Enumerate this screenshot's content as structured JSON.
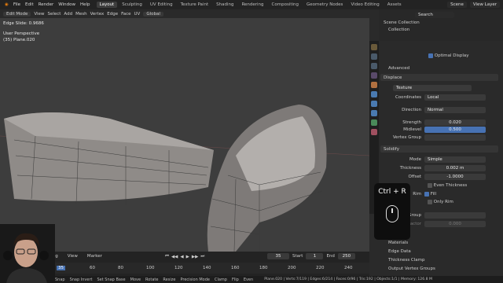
{
  "menu": [
    "File",
    "Edit",
    "Render",
    "Window",
    "Help"
  ],
  "workspaces": [
    "Layout",
    "Sculpting",
    "UV Editing",
    "Texture Paint",
    "Shading",
    "Rendering",
    "Compositing",
    "Geometry Nodes",
    "Video Editing",
    "Assets"
  ],
  "scene_label": "Scene",
  "view_layer_label": "View Layer",
  "header": {
    "mode": "Edit Mode",
    "items": [
      "View",
      "Select",
      "Add",
      "Mesh",
      "Vertex",
      "Edge",
      "Face",
      "UV"
    ],
    "transform": "Global"
  },
  "viewport": {
    "edge_slide": "Edge Slide: 0.9686",
    "perspective": "User Perspective",
    "object": "(35) Plane.020"
  },
  "outliner": {
    "search_placeholder": "Search",
    "scene_collection": "Scene Collection",
    "collection": "Collection"
  },
  "properties": {
    "optimal_display": "Optimal Display",
    "advanced": "Advanced",
    "displace": {
      "name": "Displace",
      "texture": "Texture",
      "coordinates_label": "Coordinates",
      "coordinates": "Local",
      "direction_label": "Direction",
      "direction": "Normal",
      "strength_label": "Strength",
      "strength": "0.020",
      "midlevel_label": "Midlevel",
      "midlevel": "0.500",
      "vertex_group_label": "Vertex Group"
    },
    "solidify": {
      "name": "Solidify",
      "mode_label": "Mode",
      "mode": "Simple",
      "thickness_label": "Thickness",
      "thickness": "0.002 m",
      "offset_label": "Offset",
      "offset": "-1.0000",
      "even_thickness": "Even Thickness",
      "rim_label": "Rim",
      "fill": "Fill",
      "only_rim": "Only Rim",
      "group_label": "x Group",
      "factor_label": "Factor",
      "factor": "0.000"
    },
    "panels": [
      "Materials",
      "Edge Data",
      "Thickness Clamp",
      "Output Vertex Groups"
    ]
  },
  "shortcut": {
    "keys": "Ctrl + R"
  },
  "timeline": {
    "playback": "ying",
    "view": "View",
    "marker": "Marker",
    "frame": "35",
    "start_label": "Start",
    "start": "1",
    "end_label": "End",
    "end": "250",
    "ticks": [
      "35",
      "60",
      "80",
      "100",
      "120",
      "140",
      "160",
      "180",
      "200",
      "220",
      "240"
    ]
  },
  "status": {
    "items": [
      "Snap",
      "Snap Invert",
      "Set Snap Base",
      "Move",
      "Rotate",
      "Resize",
      "Precision Mode",
      "Clamp",
      "Flip",
      "Even"
    ],
    "stats": "Plane.020 | Verts:7/119 | Edges:6/214 | Faces:0/96 | Tris:192 | Objects:1/1 | Memory: 126.8 M"
  }
}
